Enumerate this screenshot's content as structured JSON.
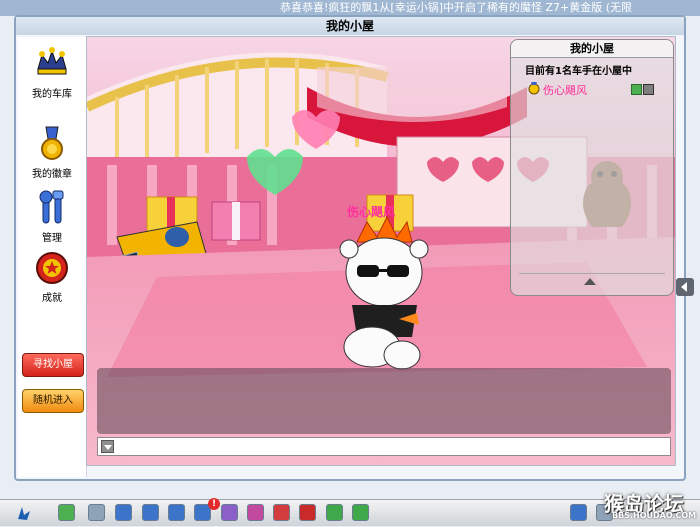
{
  "ticker": "恭喜恭喜!疯狂的飘1从[幸运小锅]中开启了稀有的魔怪 Z7+黄金版 (无限",
  "window": {
    "title": "我的小屋"
  },
  "sidebar": {
    "items": [
      {
        "label": "我的车库",
        "icon": "garage-crown-icon"
      },
      {
        "label": "我的徽章",
        "icon": "medal-icon"
      },
      {
        "label": "管理",
        "icon": "wrench-tools-icon"
      },
      {
        "label": "成就",
        "icon": "achievement-icon"
      }
    ],
    "find_room_label": "寻找小屋",
    "random_enter_label": "随机进入"
  },
  "room_panel": {
    "title": "我的小屋",
    "info": "目前有1名车手在小屋中",
    "players": [
      {
        "name": "伤心飓风"
      }
    ]
  },
  "scene": {
    "player_name": "伤心飓风"
  },
  "watermark": {
    "text": "猴岛论坛",
    "sub": "BBS.HOUDAO.COM"
  },
  "taskbar": {
    "notification_count": "!"
  },
  "colors": {
    "accent_red": "#d4231a",
    "accent_orange": "#f08a10",
    "player_pink": "#ff2fa0"
  }
}
